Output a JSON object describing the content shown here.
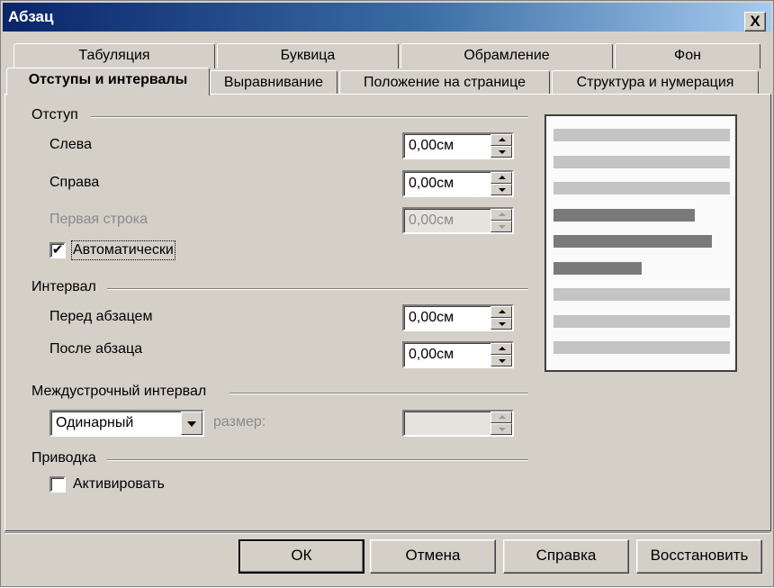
{
  "window": {
    "title": "Абзац",
    "close_glyph": "X"
  },
  "tabs_row1": [
    {
      "label": "Табуляция"
    },
    {
      "label": "Буквица"
    },
    {
      "label": "Обрамление"
    },
    {
      "label": "Фон"
    }
  ],
  "tabs_row2": [
    {
      "label": "Отступы и интервалы",
      "active": true
    },
    {
      "label": "Выравнивание"
    },
    {
      "label": "Положение на странице"
    },
    {
      "label": "Структура и нумерация"
    }
  ],
  "indent": {
    "group_label": "Отступ",
    "left_label": "Слева",
    "left_value": "0,00см",
    "right_label": "Справа",
    "right_value": "0,00см",
    "first_line_label": "Первая строка",
    "first_line_value": "0,00см",
    "auto_label": "Автоматически",
    "auto_checked": true,
    "check_glyph": "✔"
  },
  "spacing": {
    "group_label": "Интервал",
    "before_label": "Перед абзацем",
    "before_value": "0,00см",
    "after_label": "После абзаца",
    "after_value": "0,00см"
  },
  "line_spacing": {
    "group_label": "Междустрочный интервал",
    "selected": "Одинарный",
    "size_label": "размер:",
    "size_value": ""
  },
  "register": {
    "group_label": "Приводка",
    "activate_label": "Активировать",
    "activate_checked": false
  },
  "preview": {
    "colors": {
      "light": "#c4c4c4",
      "dark": "#7a7a7a"
    },
    "lines": [
      {
        "shade": "light",
        "length": 1.0
      },
      {
        "shade": "light",
        "length": 1.0
      },
      {
        "shade": "light",
        "length": 1.0
      },
      {
        "shade": "dark",
        "length": 0.8
      },
      {
        "shade": "dark",
        "length": 0.9
      },
      {
        "shade": "dark",
        "length": 0.5
      },
      {
        "shade": "light",
        "length": 1.0
      },
      {
        "shade": "light",
        "length": 1.0
      },
      {
        "shade": "light",
        "length": 1.0
      }
    ]
  },
  "buttons": {
    "ok": "ОК",
    "cancel": "Отмена",
    "help": "Справка",
    "reset": "Восстановить"
  }
}
